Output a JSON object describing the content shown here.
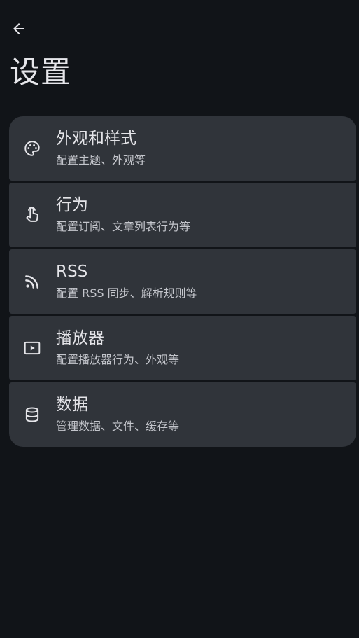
{
  "page": {
    "title": "设置"
  },
  "toolbar": {
    "back_icon": "arrow-back-icon"
  },
  "settings": [
    {
      "title": "外观和样式",
      "subtitle": "配置主题、外观等",
      "icon": "palette-icon"
    },
    {
      "title": "行为",
      "subtitle": "配置订阅、文章列表行为等",
      "icon": "touch-icon"
    },
    {
      "title": "RSS",
      "subtitle": "配置 RSS 同步、解析规则等",
      "icon": "rss-icon"
    },
    {
      "title": "播放器",
      "subtitle": "配置播放器行为、外观等",
      "icon": "play-icon"
    },
    {
      "title": "数据",
      "subtitle": "管理数据、文件、缓存等",
      "icon": "database-icon"
    }
  ],
  "colors": {
    "background": "#111418",
    "card": "#30343a",
    "text_primary": "#e4e4e8",
    "text_secondary": "#c4c6cc"
  }
}
